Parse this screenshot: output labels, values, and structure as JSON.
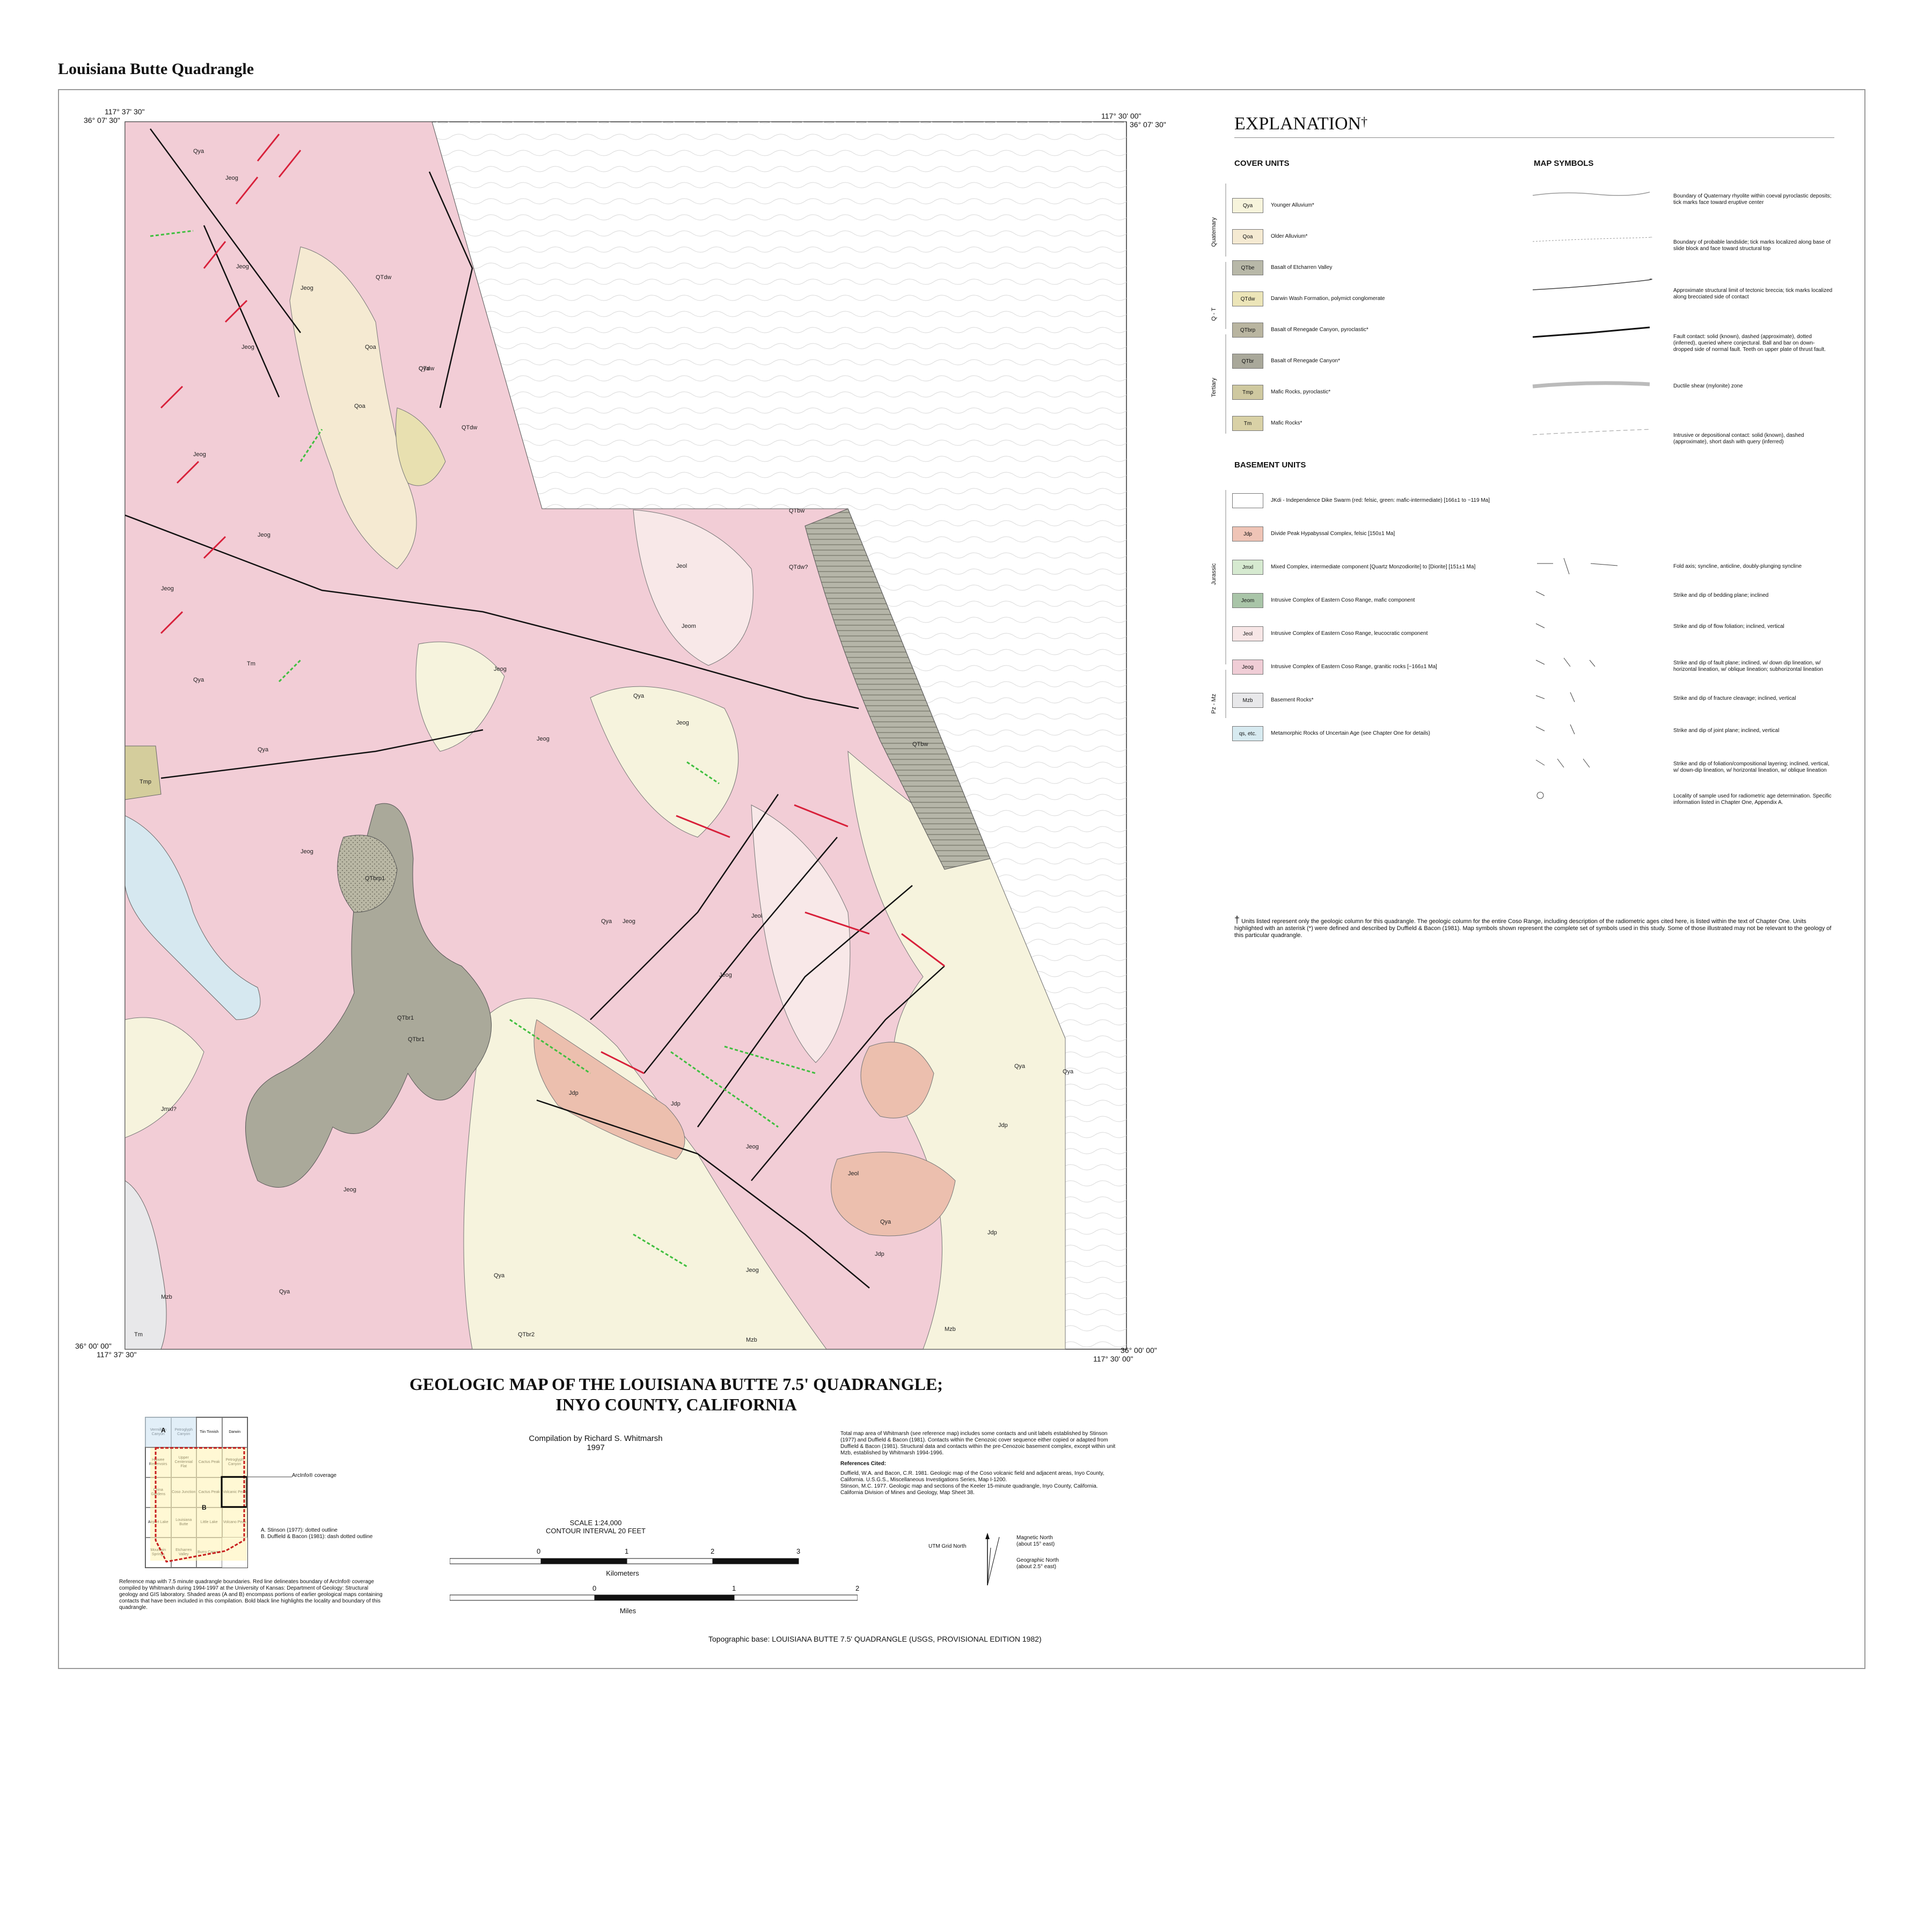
{
  "page_heading": "Louisiana Butte Quadrangle",
  "map": {
    "corner_labels": {
      "top_left_lon": "117° 37' 30\"",
      "top_left_lat": "36° 07' 30\"",
      "top_right_lon": "117° 30' 00\"",
      "top_right_lat": "36° 07' 30\"",
      "bottom_left_lat": "36° 00' 00\"",
      "bottom_left_lon": "117° 37' 30\"",
      "bottom_right_lat": "36° 00' 00\"",
      "bottom_right_lon": "117° 30' 00\""
    },
    "unit_labels": [
      "Qya",
      "Jeog",
      "Jeog",
      "Jeog",
      "QTdw",
      "QTdw",
      "Qoa",
      "Qya",
      "Qoa",
      "QTdw",
      "Jeog",
      "Jeog",
      "Jeog",
      "Jeog",
      "Qya",
      "Tm",
      "Tmp",
      "Qya",
      "Jeog",
      "QTdw?",
      "QTbw",
      "Jeol",
      "Jeom",
      "Jeog",
      "Jeog",
      "Jeog",
      "Qya",
      "QTbw",
      "QTbrp1",
      "QTbr1",
      "Jeog",
      "Jeol",
      "Jeog",
      "Qya",
      "Jdp",
      "Jdp",
      "Jeol",
      "Jeog",
      "Jeog",
      "Qya",
      "Jdp",
      "Jdp",
      "Jdp",
      "Qya",
      "Jeog",
      "Qya",
      "Mzb",
      "Mzb",
      "Mzb",
      "Tm",
      "Jmxl?",
      "Qya",
      "Qya",
      "QTbr1",
      "QTbr2"
    ]
  },
  "explanation": {
    "title": "EXPLANATION",
    "dagger": "†",
    "cover_header": "COVER UNITS",
    "symbols_header": "MAP SYMBOLS",
    "basement_header": "BASEMENT UNITS",
    "age_labels": {
      "quaternary": "Quaternary",
      "qt": "Q - T",
      "tertiary": "Tertiary",
      "jurassic": "Jurassic",
      "pzmz": "Pz - Mz"
    },
    "cover_units": [
      {
        "code": "Qya",
        "desc": "Younger Alluvium*",
        "color": "#f7f4dc"
      },
      {
        "code": "Qoa",
        "desc": "Older Alluvium*",
        "color": "#f5ead2"
      },
      {
        "code": "QTbe",
        "desc": "Basalt of Etcharren Valley",
        "color": "#b8b8a8"
      },
      {
        "code": "QTdw",
        "desc": "Darwin Wash Formation, polymict conglomerate",
        "color": "#ece5b8"
      },
      {
        "code": "QTbrp",
        "desc": "Basalt of Renegade Canyon, pyroclastic*",
        "color": "#b9b5a0"
      },
      {
        "code": "QTbr",
        "desc": "Basalt of Renegade Canyon*",
        "color": "#a9a89a"
      },
      {
        "code": "Tmp",
        "desc": "Mafic Rocks, pyroclastic*",
        "color": "#cfc9a0"
      },
      {
        "code": "Tm",
        "desc": "Mafic Rocks*",
        "color": "#d9d1a6"
      }
    ],
    "basement_units": [
      {
        "code": "",
        "desc": "JKdi - Independence Dike Swarm (red: felsic, green: mafic-intermediate) [166±1 to ~119 Ma]",
        "color": "#ffffff"
      },
      {
        "code": "Jdp",
        "desc": "Divide Peak Hypabyssal Complex, felsic [150±1 Ma]",
        "color": "#efc4b6"
      },
      {
        "code": "Jmxl",
        "desc": "Mixed Complex, intermediate component [Quartz Monzodiorite] to [Diorite] [151±1 Ma]",
        "color": "#d6ead0"
      },
      {
        "code": "Jeom",
        "desc": "Intrusive Complex of Eastern Coso Range, mafic component",
        "color": "#a9c5a8"
      },
      {
        "code": "Jeol",
        "desc": "Intrusive Complex of Eastern Coso Range, leucocratic component",
        "color": "#f7e6e6"
      },
      {
        "code": "Jeog",
        "desc": "Intrusive Complex of Eastern Coso Range, granitic rocks [~166±1 Ma]",
        "color": "#f0cdd6"
      },
      {
        "code": "Mzb",
        "desc": "Basement Rocks*",
        "color": "#e8e8ea"
      },
      {
        "code": "qs, etc.",
        "desc": "Metamorphic Rocks of Uncertain Age (see Chapter One for details)",
        "color": "#d7eaf0"
      }
    ],
    "map_symbols": [
      "Boundary of Quaternary rhyolite within coeval pyroclastic deposits; tick marks face toward eruptive center",
      "Boundary of probable landslide; tick marks localized along base of slide block and face toward structural top",
      "Approximate structural limit of tectonic breccia; tick marks localized along brecciated side of contact",
      "Fault contact: solid (known), dashed (approximate), dotted (inferred), queried where conjectural. Ball and bar on down-dropped side of normal fault. Teeth on upper plate of thrust fault.",
      "Ductile shear (mylonite) zone",
      "Intrusive or depositional contact: solid (known), dashed (approximate), short dash with query (inferred)",
      "Fold axis; syncline, anticline, doubly-plunging syncline",
      "Strike and dip of bedding plane; inclined",
      "Strike and dip of flow foliation; inclined, vertical",
      "Strike and dip of fault plane; inclined, w/ down dip lineation, w/ horizontal lineation, w/ oblique lineation; subhorizontal lineation",
      "Strike and dip of fracture cleavage; inclined, vertical",
      "Strike and dip of joint plane; inclined, vertical",
      "Strike and dip of foliation/compositional layering; inclined, vertical, w/ down-dip lineation, w/ horizontal lineation, w/ oblique lineation",
      "Locality of sample used for radiometric age determination. Specific information listed in Chapter One, Appendix A."
    ],
    "footnote": "Units listed represent only the geologic column for this quadrangle. The geologic column for the entire Coso Range, including description of the radiometric ages cited here, is listed within the text of Chapter One. Units highlighted with an asterisk (*) were defined and described by Duffield & Bacon (1981). Map symbols shown represent the complete set of symbols used in this study. Some of those illustrated may not be relevant to the geology of this particular quadrangle."
  },
  "title_block": {
    "line1": "GEOLOGIC MAP OF THE LOUISIANA BUTTE 7.5' QUADRANGLE;",
    "line2": "INYO COUNTY, CALIFORNIA",
    "compilation": "Compilation by Richard S. Whitmarsh",
    "year": "1997",
    "scale": "SCALE 1:24,000",
    "contour": "CONTOUR INTERVAL 20 FEET",
    "km_ticks": [
      "0",
      "1",
      "2",
      "3"
    ],
    "km_label": "Kilometers",
    "mi_ticks": [
      "0",
      "1",
      "2"
    ],
    "mi_label": "Miles",
    "topo_base": "Topographic base: LOUISIANA BUTTE 7.5' QUADRANGLE (USGS, PROVISIONAL EDITION 1982)"
  },
  "notes": {
    "p1": "Total map area of Whitmarsh (see reference map) includes some contacts and unit labels established by Stinson (1977) and Duffield & Bacon (1981). Contacts within the Cenozoic cover sequence either copied or adapted from Duffield & Bacon (1981). Structural data and contacts within the pre-Cenozoic basement complex, except within unit Mzb, established by Whitmarsh 1994-1996.",
    "refs_header": "References Cited:",
    "ref1": "Duffield, W.A. and Bacon, C.R. 1981. Geologic map of the Coso volcanic field and adjacent areas, Inyo County, California. U.S.G.S., Miscellaneous Investigations Series, Map I-1200.",
    "ref2": "Stinson, M.C. 1977. Geologic map and sections of the Keeler 15-minute quadrangle, Inyo County, California. California Division of Mines and Geology, Map Sheet 38."
  },
  "north_arrow": {
    "utm": "UTM Grid North",
    "magnetic": "Magnetic North",
    "magnetic_note": "(about 15° east)",
    "geographic": "Geographic North",
    "geographic_note": "(about 2.5° east)"
  },
  "reference_map": {
    "cells": [
      "Vermillion Canyon",
      "Petroglyph Canyon",
      "Tiin Tinnish",
      "Darwin",
      "Haiwee Reservoirs",
      "Upper Centennial Flat",
      "Cactus Peak",
      "Petroglyph Canyon",
      "China Gardens",
      "Coso Junction",
      "Cactus Peak",
      "Volcanic Peak",
      "Airport Lake",
      "Louisiana Butte",
      "Little Lake",
      "Volcano Peak",
      "Mountain Springs",
      "Etcharren Valley",
      "Burro Canyon"
    ],
    "label_a": "A",
    "label_b": "B",
    "arcinfo": "ArcInfo® coverage",
    "legend_a": "A. Stinson (1977): dotted outline",
    "legend_b": "B. Duffield & Bacon (1981): dash dotted outline",
    "caption": "Reference map with 7.5 minute quadrangle boundaries. Red line delineates boundary of ArcInfo® coverage compiled by Whitmarsh during 1994-1997 at the University of Kansas: Department of Geology: Structural geology and GIS laboratory. Shaded areas (A and B) encompass portions of earlier geological maps containing contacts that have been included in this compilation. Bold black line highlights the locality and boundary of this quadrangle."
  }
}
